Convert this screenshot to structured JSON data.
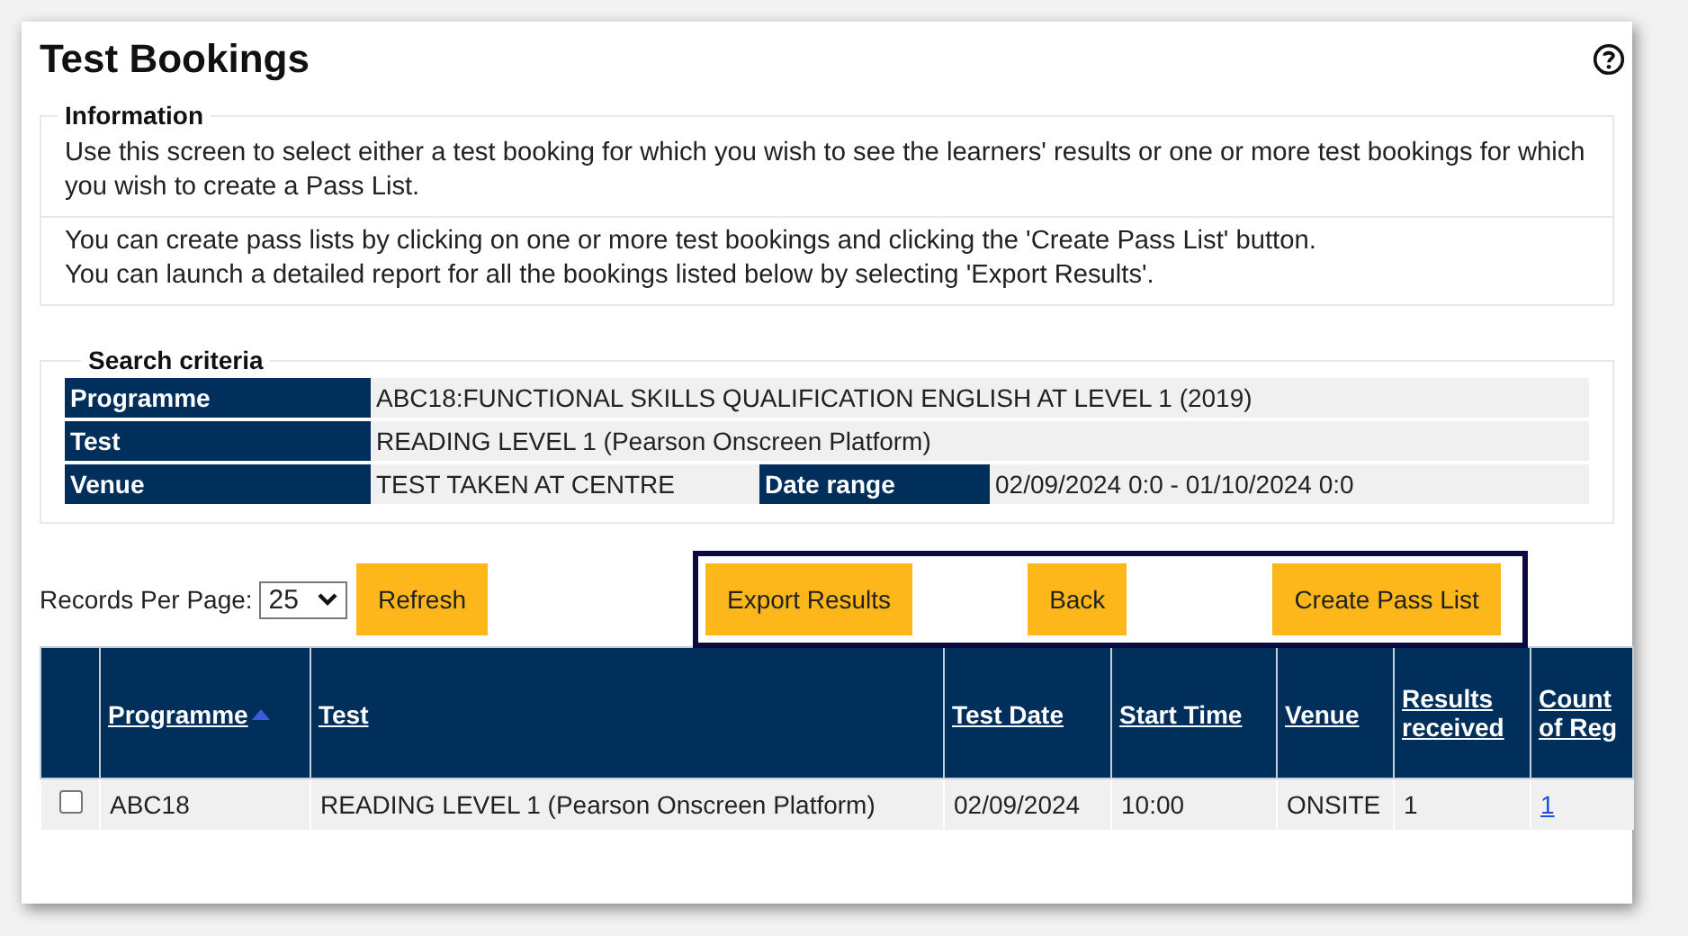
{
  "page": {
    "title": "Test Bookings"
  },
  "information": {
    "legend": "Information",
    "paragraphs": [
      {
        "lines": [
          "Use this screen to select either a test booking for which you wish to see the learners' results or one or more test bookings for which you wish to create a Pass List."
        ]
      },
      {
        "lines": [
          "You can create pass lists by clicking on one or more test bookings and clicking the 'Create Pass List' button.",
          "You can launch a detailed report for all the bookings listed below by selecting 'Export Results'."
        ]
      }
    ]
  },
  "search_criteria": {
    "legend": "Search criteria",
    "rows": [
      {
        "cells": [
          {
            "kind": "label",
            "text": "Programme"
          },
          {
            "kind": "value",
            "text": "ABC18:FUNCTIONAL SKILLS QUALIFICATION ENGLISH AT LEVEL 1 (2019)"
          }
        ]
      },
      {
        "cells": [
          {
            "kind": "label",
            "text": "Test"
          },
          {
            "kind": "value",
            "text": "READING LEVEL 1 (Pearson Onscreen Platform)"
          }
        ]
      },
      {
        "cells": [
          {
            "kind": "label",
            "text": "Venue"
          },
          {
            "kind": "value",
            "text": "TEST TAKEN AT CENTRE"
          },
          {
            "kind": "label",
            "text": "Date range"
          },
          {
            "kind": "value",
            "text": "02/09/2024 0:0 - 01/10/2024 0:0"
          }
        ]
      }
    ]
  },
  "records_per_page": {
    "label": "Records Per Page:",
    "value": "25"
  },
  "refresh_button": "Refresh",
  "action_buttons": [
    "Export Results",
    "Back",
    "Create Pass List"
  ],
  "table": {
    "columns": [
      {
        "label": "Programme",
        "sorted": true
      },
      {
        "label": "Test",
        "sorted": false
      },
      {
        "label": "Test Date",
        "sorted": false
      },
      {
        "label": "Start Time",
        "sorted": false
      },
      {
        "label": "Venue",
        "sorted": false
      },
      {
        "label": "Results received",
        "sorted": false
      },
      {
        "label": "Count of Reg",
        "sorted": false
      }
    ],
    "rows": [
      {
        "checked": false,
        "cells": [
          "ABC18",
          "READING LEVEL 1 (Pearson Onscreen Platform)",
          "02/09/2024",
          "10:00",
          "ONSITE",
          "1",
          "1"
        ]
      }
    ]
  }
}
